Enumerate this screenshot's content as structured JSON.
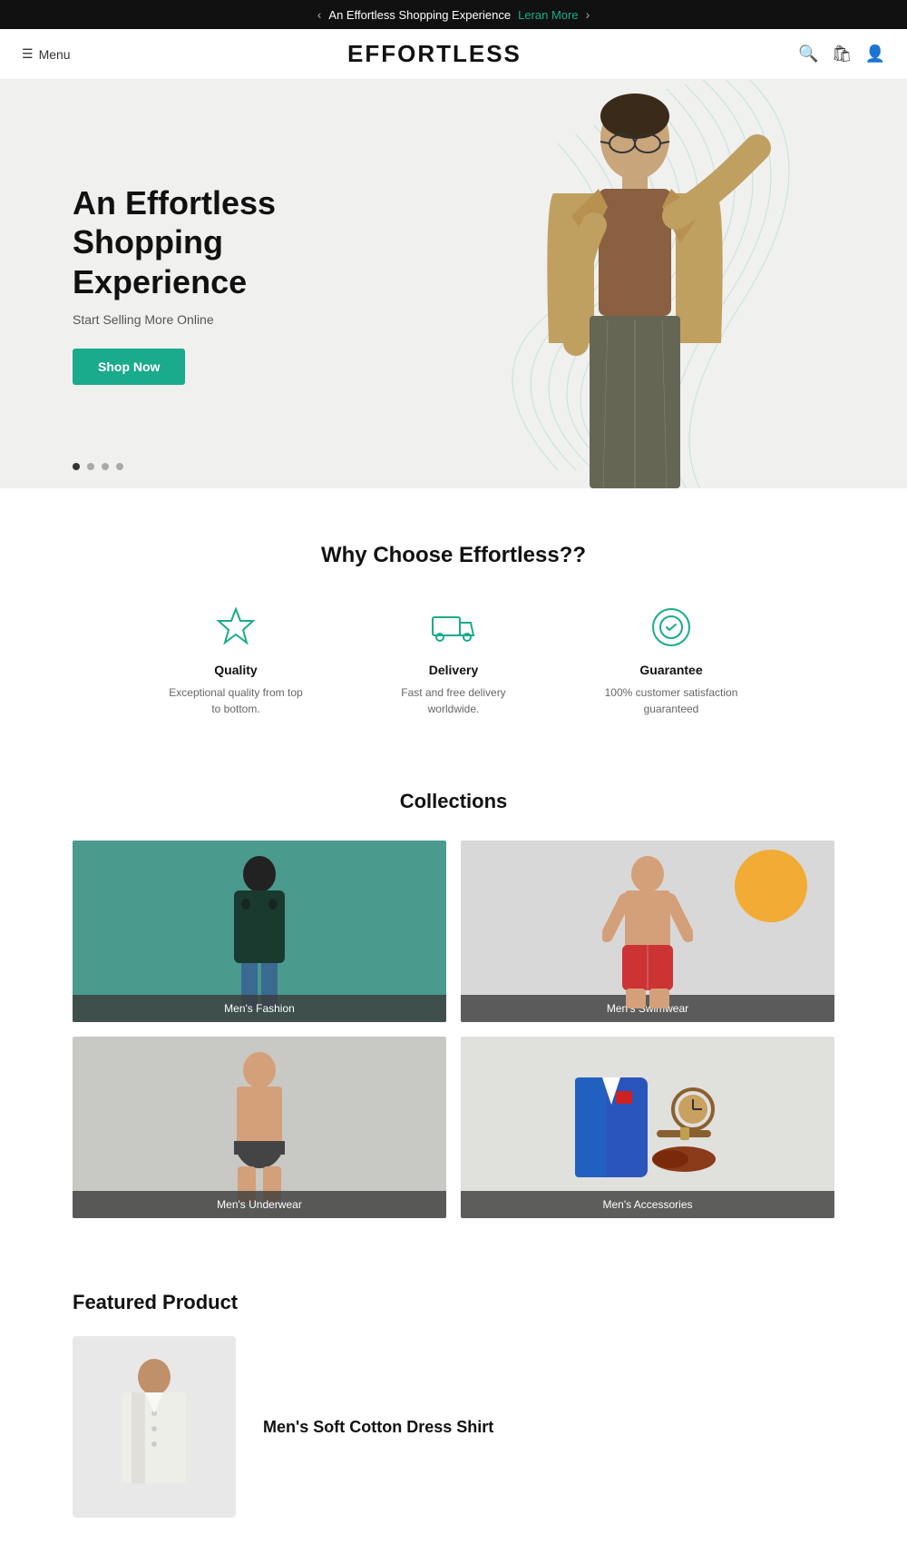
{
  "announcement": {
    "text": "An Effortless Shopping Experience",
    "link_text": "Leran More",
    "prev_label": "‹",
    "next_label": "›"
  },
  "header": {
    "menu_label": "Menu",
    "logo": "EFFORTLESS",
    "icons": {
      "search": "🔍",
      "bag": "🛍",
      "user": "👤"
    }
  },
  "hero": {
    "heading_line1": "An Effortless",
    "heading_line2": "Shopping Experience",
    "subtext": "Start Selling More Online",
    "cta_label": "Shop Now",
    "dots": [
      true,
      false,
      false,
      false
    ]
  },
  "why_choose": {
    "heading": "Why Choose Effortless??",
    "features": [
      {
        "icon": "star",
        "title": "Quality",
        "description": "Exceptional quality from top to bottom."
      },
      {
        "icon": "truck",
        "title": "Delivery",
        "description": "Fast and free delivery worldwide."
      },
      {
        "icon": "guarantee",
        "title": "Guarantee",
        "description": "100% customer satisfaction guaranteed"
      }
    ]
  },
  "collections": {
    "heading": "Collections",
    "items": [
      {
        "label": "Men's Fashion",
        "theme": "teal"
      },
      {
        "label": "Men's Swimwear",
        "theme": "light-gray"
      },
      {
        "label": "Men's Underwear",
        "theme": "gray"
      },
      {
        "label": "Men's Accessories",
        "theme": "light-gray2"
      }
    ]
  },
  "featured": {
    "heading": "Featured Product",
    "product_name": "Men's Soft Cotton Dress Shirt"
  },
  "colors": {
    "teal": "#1aaa8c",
    "dark": "#111111",
    "accent_bar": "#111111"
  }
}
